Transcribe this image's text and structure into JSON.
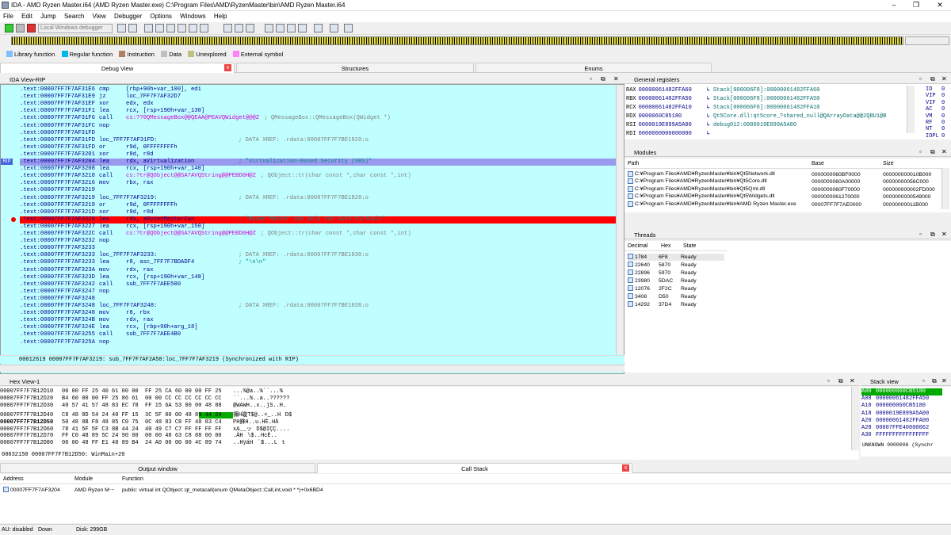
{
  "window": {
    "title": "IDA - AMD Ryzen Master.i64 (AMD Ryzen Master.exe) C:\\Program Files\\AMD\\RyzenMaster\\bin\\AMD Ryzen Master.i64",
    "controls": [
      "–",
      "❐",
      "✕"
    ]
  },
  "menu": [
    "File",
    "Edit",
    "Jump",
    "Search",
    "View",
    "Debugger",
    "Options",
    "Windows",
    "Help"
  ],
  "toolbar": {
    "debugger_select": "Local Windows debugger"
  },
  "legend": [
    {
      "label": "Library function",
      "color": "#80c0ff"
    },
    {
      "label": "Regular function",
      "color": "#00b7eb"
    },
    {
      "label": "Instruction",
      "color": "#b08060"
    },
    {
      "label": "Data",
      "color": "#c0c0c0"
    },
    {
      "label": "Unexplored",
      "color": "#c0c080"
    },
    {
      "label": "External symbol",
      "color": "#ff80ff"
    }
  ],
  "tabs": [
    {
      "label": "Debug View",
      "close": "x"
    },
    {
      "label": "Structures"
    },
    {
      "label": "Enums"
    }
  ],
  "ida_view": {
    "title": "IDA View-RIP",
    "lines": [
      {
        "addr": ".text:00007FF7F7AF31E6",
        "op": "cmp",
        "args": "[rbp+90h+var_100], edi",
        "cmt": ""
      },
      {
        "addr": ".text:00007FF7F7AF31E9",
        "op": "jz",
        "args": "loc_7FF7F7AF32D7",
        "cmt": ""
      },
      {
        "addr": ".text:00007FF7F7AF31EF",
        "op": "xor",
        "args": "edx, edx",
        "cmt": ""
      },
      {
        "addr": ".text:00007FF7F7AF31F1",
        "op": "lea",
        "args": "rcx, [rsp+190h+var_130]",
        "cmt": ""
      },
      {
        "addr": ".text:00007FF7F7AF31F6",
        "op": "call",
        "args": "cs:??0QMessageBox@@QEAA@PEAVQWidget@@@Z",
        "cmt": "; QMessageBox::QMessageBox(QWidget *)"
      },
      {
        "addr": ".text:00007FF7F7AF31FC",
        "op": "nop",
        "args": "",
        "cmt": ""
      },
      {
        "addr": ".text:00007FF7F7AF31FD",
        "op": "",
        "args": "",
        "cmt": ""
      },
      {
        "addr": ".text:00007FF7F7AF31FD",
        "op": "loc_7FF7F7AF31FD:",
        "args": "",
        "cmt": "; DATA XREF: .rdata:00007FF7F7BE1820↓o"
      },
      {
        "addr": ".text:00007FF7F7AF31FD",
        "op": "or",
        "args": "r9d, 0FFFFFFFFh",
        "cmt": ""
      },
      {
        "addr": ".text:00007FF7F7AF3201",
        "op": "xor",
        "args": "r8d, r8d",
        "cmt": ""
      },
      {
        "addr": ".text:00007FF7F7AF3204",
        "op": "lea",
        "args": "rdx, aVirtualization",
        "cmt": "; \"Virtualization-Based Security (VBS)\""
      },
      {
        "addr": ".text:00007FF7F7AF3208",
        "op": "lea",
        "args": "rcx, [rsp+190h+var_140]",
        "cmt": ""
      },
      {
        "addr": ".text:00007FF7F7AF3210",
        "op": "call",
        "args": "cs:?tr@QObject@@SA?AVQString@@PEBD0H@Z",
        "cmt": "; QObject::tr(char const *,char const *,int)"
      },
      {
        "addr": ".text:00007FF7F7AF3216",
        "op": "mov",
        "args": "rbx, rax",
        "cmt": ""
      },
      {
        "addr": ".text:00007FF7F7AF3219",
        "op": "",
        "args": "",
        "cmt": ""
      },
      {
        "addr": ".text:00007FF7F7AF3219",
        "op": "loc_7FF7F7AF3219:",
        "args": "",
        "cmt": "; DATA XREF: .rdata:00007FF7F7BE1828↓o"
      },
      {
        "addr": ".text:00007FF7F7AF3219",
        "op": "or",
        "args": "r9d, 0FFFFFFFFh",
        "cmt": ""
      },
      {
        "addr": ".text:00007FF7F7AF321D",
        "op": "xor",
        "args": "r8d, r8d",
        "cmt": ""
      },
      {
        "addr": ".text:00007FF7F7AF3220",
        "op": "lea",
        "args": "rdx, aRyzenMasterCan",
        "cmt": "; \"Ryzen Master can only run with Virtuali\"..."
      },
      {
        "addr": ".text:00007FF7F7AF3227",
        "op": "lea",
        "args": "rcx, [rsp+190h+var_150]",
        "cmt": ""
      },
      {
        "addr": ".text:00007FF7F7AF322C",
        "op": "call",
        "args": "cs:?tr@QObject@@SA?AVQString@@PEBD0H@Z",
        "cmt": "; QObject::tr(char const *,char const *,int)"
      },
      {
        "addr": ".text:00007FF7F7AF3232",
        "op": "nop",
        "args": "",
        "cmt": ""
      },
      {
        "addr": ".text:00007FF7F7AF3233",
        "op": "",
        "args": "",
        "cmt": ""
      },
      {
        "addr": ".text:00007FF7F7AF3233",
        "op": "loc_7FF7F7AF3233:",
        "args": "",
        "cmt": "; DATA XREF: .rdata:00007FF7F7BE1830↓o"
      },
      {
        "addr": ".text:00007FF7F7AF3233",
        "op": "lea",
        "args": "r8, asc_7FF7F7BDADF4",
        "cmt": "; \"\\n\\n\""
      },
      {
        "addr": ".text:00007FF7F7AF323A",
        "op": "mov",
        "args": "rdx, rax",
        "cmt": ""
      },
      {
        "addr": ".text:00007FF7F7AF323D",
        "op": "lea",
        "args": "rcx, [rsp+190h+var_148]",
        "cmt": ""
      },
      {
        "addr": ".text:00007FF7F7AF3242",
        "op": "call",
        "args": "sub_7FF7F7AEE500",
        "cmt": ""
      },
      {
        "addr": ".text:00007FF7F7AF3247",
        "op": "nop",
        "args": "",
        "cmt": ""
      },
      {
        "addr": ".text:00007FF7F7AF3248",
        "op": "",
        "args": "",
        "cmt": ""
      },
      {
        "addr": ".text:00007FF7F7AF3248",
        "op": "loc_7FF7F7AF3248:",
        "args": "",
        "cmt": "; DATA XREF: .rdata:00007FF7F7BE1838↓o"
      },
      {
        "addr": ".text:00007FF7F7AF3248",
        "op": "mov",
        "args": "r8, rbx",
        "cmt": ""
      },
      {
        "addr": ".text:00007FF7F7AF324B",
        "op": "mov",
        "args": "rdx, rax",
        "cmt": ""
      },
      {
        "addr": ".text:00007FF7F7AF324E",
        "op": "lea",
        "args": "rcx, [rbp+90h+arg_18]",
        "cmt": ""
      },
      {
        "addr": ".text:00007FF7F7AF3255",
        "op": "call",
        "args": "sub_7FF7F7AEE4B0",
        "cmt": ""
      },
      {
        "addr": ".text:00007FF7F7AF325A",
        "op": "nop",
        "args": "",
        "cmt": ""
      }
    ],
    "rip_label": "RIP",
    "status": "00012619 00007FF7F7AF3219: sub_7FF7F7AF2A50:loc_7FF7F7AF3219 (Synchronized with RIP)"
  },
  "registers": {
    "title": "General registers",
    "rows": [
      {
        "name": "RAX",
        "val": "00000061482FFA60",
        "ref": "Stack[000006F8]:00000061482FFA60"
      },
      {
        "name": "RBX",
        "val": "00000061482FFA50",
        "ref": "Stack[000006F8]:00000061482FFA50"
      },
      {
        "name": "RCX",
        "val": "00000061482FFA10",
        "ref": "Stack[000006F8]:00000061482FFA10"
      },
      {
        "name": "RDX",
        "val": "0000060C85180",
        "ref": "Qt5Core.dll:qt5core_?shared_null@QArrayData@@2QBU1@B"
      },
      {
        "name": "RSI",
        "val": "0000019E899A5A00",
        "ref": "debug012:0000019E899A5A00"
      },
      {
        "name": "RDI",
        "val": "0000000000000000",
        "ref": ""
      }
    ],
    "flags": [
      {
        "name": "ID",
        "val": "0"
      },
      {
        "name": "VIP",
        "val": "0"
      },
      {
        "name": "VIF",
        "val": "0"
      },
      {
        "name": "AC",
        "val": "0"
      },
      {
        "name": "VM",
        "val": "0"
      },
      {
        "name": "RF",
        "val": "0"
      },
      {
        "name": "NT",
        "val": "0"
      },
      {
        "name": "IOPL",
        "val": "0"
      }
    ]
  },
  "modules": {
    "title": "Modules",
    "headers": [
      "Path",
      "Base",
      "Size"
    ],
    "rows": [
      {
        "path": "C:¥Program Files¥AMD¥RyzenMaster¥bin¥Qt5Network.dll",
        "base": "0000000060BF0000",
        "size": "000000000010B000"
      },
      {
        "path": "C:¥Program Files¥AMD¥RyzenMaster¥bin¥Qt5Core.dll",
        "base": "0000000060A00000",
        "size": "00000000056C000"
      },
      {
        "path": "C:¥Program Files¥AMD¥RyzenMaster¥bin¥Qt5Qml.dll",
        "base": "0000000060F70000",
        "size": "000000000002FD000"
      },
      {
        "path": "C:¥Program Files¥AMD¥RyzenMaster¥bin¥Qt5Widgets.dll",
        "base": "0000000061270000",
        "size": "0000000000549000"
      },
      {
        "path": "C:¥Program Files¥AMD¥RyzenMaster¥bin¥AMD Ryzen Master.exe",
        "base": "00007FF7F7AE0000",
        "size": "00000000011B000"
      }
    ]
  },
  "threads": {
    "title": "Threads",
    "headers": [
      "Decimal",
      "Hex",
      "State"
    ],
    "rows": [
      {
        "dec": "1784",
        "hex": "6F8",
        "state": "Ready"
      },
      {
        "dec": "22640",
        "hex": "5870",
        "state": "Ready"
      },
      {
        "dec": "22896",
        "hex": "5970",
        "state": "Ready"
      },
      {
        "dec": "23980",
        "hex": "5DAC",
        "state": "Ready"
      },
      {
        "dec": "12076",
        "hex": "2F2C",
        "state": "Ready"
      },
      {
        "dec": "3408",
        "hex": "D50",
        "state": "Ready"
      },
      {
        "dec": "14292",
        "hex": "37D4",
        "state": "Ready"
      }
    ]
  },
  "hex_view": {
    "title": "Hex View-1",
    "rows": [
      {
        "addr": "00007FF7F7B12D10",
        "bytes": "00 00 FF 25 40 61 00 00  FF 25 CA 60 00 00 FF 25",
        "ascii": "...%@a..%ˊ`...%"
      },
      {
        "addr": "00007FF7F7B12D20",
        "bytes": "B4 60 00 00 FF 25 86 61  00 00 CC CC CC CC CC CC",
        "ascii": "´`...%..a..??????"
      },
      {
        "addr": "00007FF7F7B12D30",
        "bytes": "40 57 41 57 48 83 EC 78  FF 15 6A 53 00 00 48 88",
        "ascii": "@WAWH..x..jS..H."
      },
      {
        "addr": "00007FF7F7B12D40",
        "bytes": "C8 48 8D 54 24 40 FF 15  3C 5F 00 00 48 89 44 24",
        "ascii": "禰H璇T$@..<_..HD$"
      },
      {
        "addr": "00007FF7F7B12D50",
        "bytes": "50 48 8B F8 48 85 C0 75  0C 48 83 C8 FF 48 83 C4",
        "ascii": "PH鋒H..u.HÈ.HÄ"
      },
      {
        "addr": "00007FF7F7B12D60",
        "bytes": "78 41 5F 5F C3 8B 44 24  40 49 C7 C7 FF FF FF FF",
        "ascii": "xA__ッD$@IÇÇ...."
      },
      {
        "addr": "00007FF7F7B12D70",
        "bytes": "FF C0 48 89 5C 24 90 00  00 00 48 63 C8 88 00 00",
        "ascii": ".ÀH\\$..HcÈ.."
      },
      {
        "addr": "00007FF7F7B12D80",
        "bytes": "00 00 48 FF E1 48 89 B4  24 A0 00 00 00 4C 89 74",
        "ascii": "..HÿáH´$...Lt"
      }
    ],
    "status": "00032150 00007FF7F7B12D50: WinMain+20"
  },
  "stack_view": {
    "title": "Stack view",
    "rows": [
      {
        "off": "A00",
        "val": "000000060CB5180"
      },
      {
        "off": "A08",
        "val": "00000061482FFA50"
      },
      {
        "off": "A10",
        "val": "000000060CB5180"
      },
      {
        "off": "A18",
        "val": "0000019E899A5A00"
      },
      {
        "off": "A20",
        "val": "00000061482FFA00"
      },
      {
        "off": "A28",
        "val": "00007FFE40000062"
      },
      {
        "off": "A30",
        "val": "FFFFFFFFFFFFFFFF"
      }
    ],
    "status": "UNKNOWN 0000006 (Synchr"
  },
  "output": {
    "title": "Output window"
  },
  "callstack": {
    "title": "Call Stack",
    "headers": [
      "Address",
      "Module",
      "Function"
    ],
    "rows": [
      {
        "addr": "00007FF7F7AF3204",
        "module": "AMD Ryzen M⋯",
        "func": "public: virtual int QObject::qt_metacall(enum QMetaObject::Call,int,void * *)+0x6BD4"
      }
    ]
  },
  "status_bar": {
    "mode": "AU: disabled",
    "state": "Down",
    "disk": "Disk: 299GB"
  },
  "colors": {
    "ida_bg": "#c0ffff",
    "highlight": "#9999ee",
    "breakpoint": "#ff0000"
  }
}
